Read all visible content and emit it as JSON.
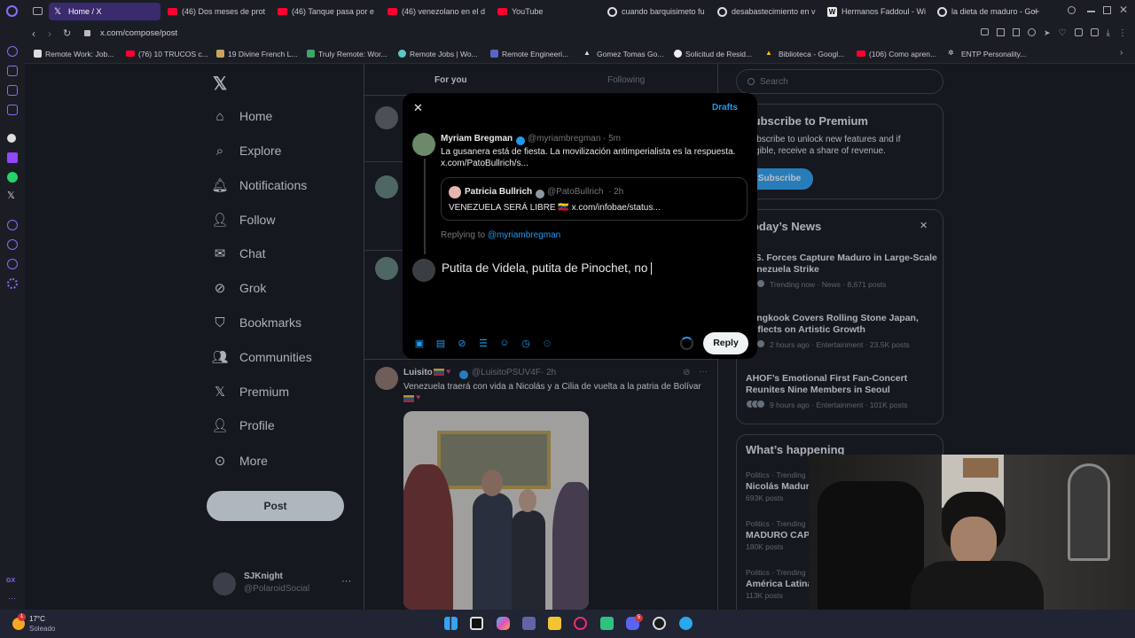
{
  "browser": {
    "tabs": [
      {
        "label": "Home / X",
        "active": true
      },
      {
        "label": "(46) Dos meses de prot"
      },
      {
        "label": "(46) Tanque pasa por e"
      },
      {
        "label": "(46) venezolano en el d"
      },
      {
        "label": "YouTube"
      },
      {
        "label": "cuando barquisimeto fu"
      },
      {
        "label": "desabastecimiento en v"
      },
      {
        "label": "Hermanos Faddoul - Wi"
      },
      {
        "label": "la dieta de maduro - Go"
      }
    ],
    "url": "x.com/compose/post",
    "bookmarks": [
      "Remote Work: Job...",
      "(76) 10 TRUCOS c...",
      "19 Divine French L...",
      "Truly Remote: Wor...",
      "Remote Jobs | Wo...",
      "Remote Engineeri...",
      "Gomez Tomas Go...",
      "Solicitud de Resid...",
      "Biblioteca - Googl...",
      "(106) Como apren...",
      "ENTP Personality..."
    ],
    "sidebar_badge": "GX"
  },
  "nav": {
    "items": [
      "Home",
      "Explore",
      "Notifications",
      "Follow",
      "Chat",
      "Grok",
      "Bookmarks",
      "Communities",
      "Premium",
      "Profile",
      "More"
    ],
    "post_button": "Post",
    "account_name": "SJKnight",
    "account_handle": "@PolaroidSocial",
    "more_dots": "···"
  },
  "timeline": {
    "tab_for_you": "For you",
    "tab_following": "Following",
    "tweet": {
      "name": "Luisito",
      "handle": "@LuisitoPSUV4F",
      "time": "· 2h",
      "text": "Venezuela traerá con vida a Nicolás y  a Cilia de vuelta a la patria de Bolívar"
    }
  },
  "modal": {
    "drafts": "Drafts",
    "author_name": "Myriam Bregman",
    "author_handle": "@myriambregman",
    "author_time": "· 5m",
    "text_line1": "La gusanera está de fiesta. La movilización antimperialista es la respuesta.",
    "text_line2": "x.com/PatoBullrich/s...",
    "quote_name": "Patricia Bullrich",
    "quote_handle": "@PatoBullrich",
    "quote_time": "· 2h",
    "quote_text": "VENEZUELA SERÁ LIBRE 🇻🇪 x.com/infobae/status...",
    "replying_prefix": "Replying to",
    "replying_handle": "@myriambregman",
    "draft_text": "Putita de Videla, putita de Pinochet, no",
    "reply_button": "Reply"
  },
  "right": {
    "search_placeholder": "Search",
    "premium_title": "Subscribe to Premium",
    "premium_text1": "Subscribe to unlock new features and if",
    "premium_text2": "eligible, receive a share of revenue.",
    "premium_button": "Subscribe",
    "news_title": "Today’s News",
    "news": [
      {
        "title1": "U.S. Forces Capture Maduro in Large-Scale",
        "title2": "Venezuela Strike",
        "meta": "Trending now · News · 8,671 posts"
      },
      {
        "title1": "Jungkook Covers Rolling Stone Japan,",
        "title2": "Reflects on Artistic Growth",
        "meta": "2 hours ago · Entertainment · 23.5K posts"
      },
      {
        "title1": "AHOF’s Emotional First Fan-Concert",
        "title2": "Reunites Nine Members in Seoul",
        "meta": "9 hours ago · Entertainment · 101K posts"
      }
    ],
    "happening_title": "What’s happening",
    "trends": [
      {
        "context": "Politics · Trending",
        "name": "Nicolás Maduro",
        "count": "693K posts"
      },
      {
        "context": "Politics · Trending",
        "name": "MADURO CAPTURADO",
        "count": "180K posts"
      },
      {
        "context": "Politics · Trending",
        "name": "América Latina",
        "count": "113K posts"
      }
    ]
  },
  "taskbar": {
    "weather_temp": "17°C",
    "weather_desc": "Soleado",
    "weather_badge": "1",
    "discord_badge": "5"
  },
  "colors": {
    "accent": "#1d9bf0",
    "brand_purple": "#7b5cf5",
    "background": "#000000",
    "muted": "#71767b"
  }
}
